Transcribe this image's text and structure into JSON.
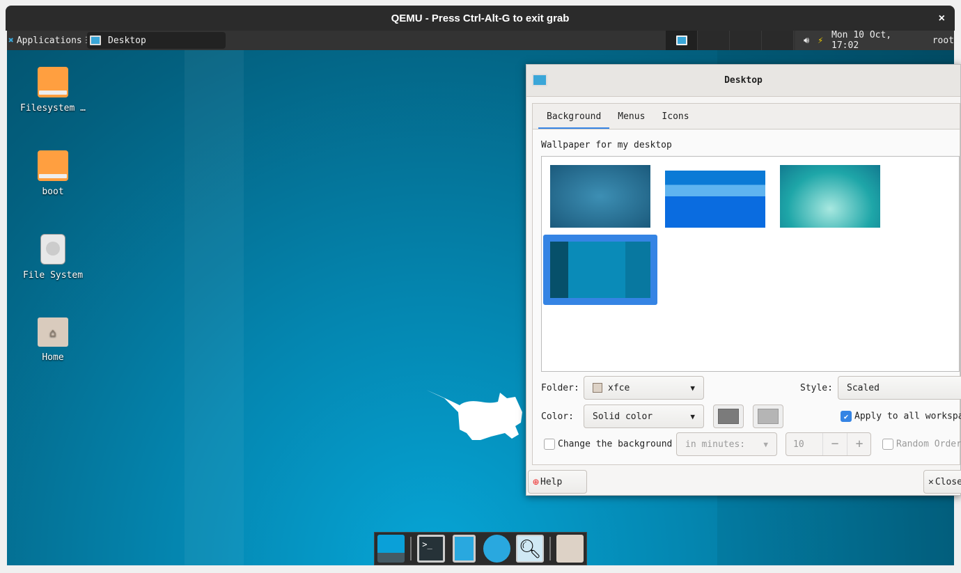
{
  "host": {
    "title": "QEMU - Press Ctrl-Alt-G to exit grab",
    "close": "×"
  },
  "panel": {
    "applications": "Applications",
    "task": "Desktop",
    "clock": "Mon 10 Oct, 17:02",
    "user": "root"
  },
  "desktop_icons": [
    {
      "label": "Filesystem …"
    },
    {
      "label": "boot"
    },
    {
      "label": "File System"
    },
    {
      "label": "Home"
    }
  ],
  "dialog": {
    "title": "Desktop",
    "tabs": [
      "Background",
      "Menus",
      "Icons"
    ],
    "wallpaper_label": "Wallpaper for my desktop",
    "folder_label": "Folder:",
    "folder_value": "xfce",
    "style_label": "Style:",
    "style_value": "Scaled",
    "color_label": "Color:",
    "color_value": "Solid color",
    "primary_color": "#7b7b7b",
    "secondary_color": "#b5b5b5",
    "apply_all": "Apply to all workspaces",
    "apply_all_checked": true,
    "change_bg": "Change the background",
    "change_bg_checked": false,
    "interval_unit": "in minutes:",
    "interval_value": "10",
    "random_order": "Random Order",
    "help": "Help",
    "close": "Close",
    "selected_wallpaper": 4
  }
}
